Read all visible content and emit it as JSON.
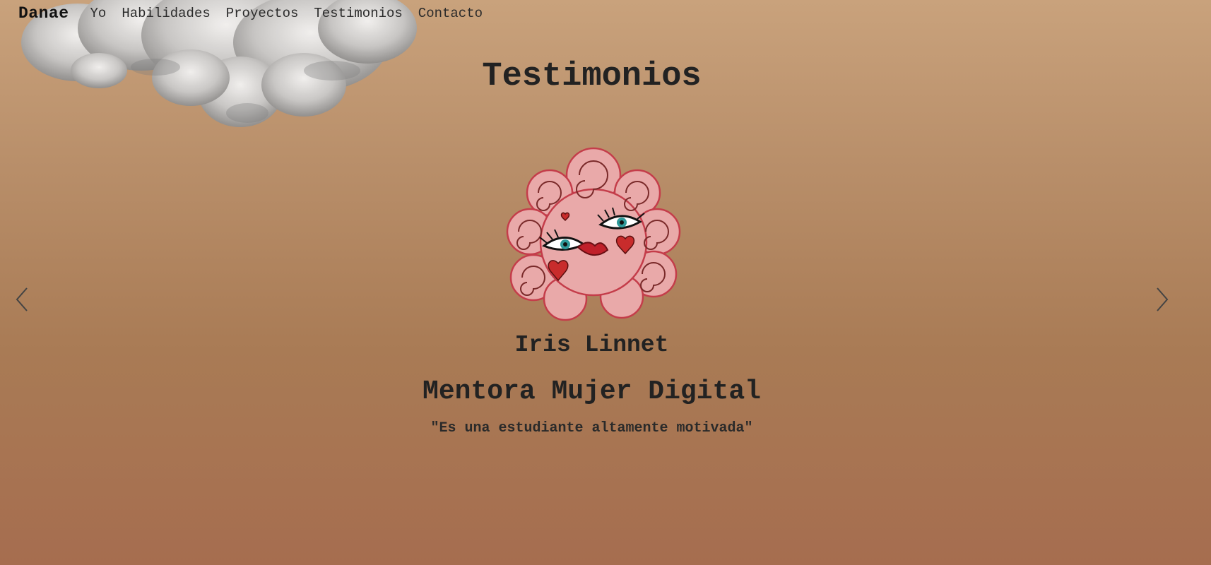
{
  "nav": {
    "brand": "Danae",
    "links": [
      "Yo",
      "Habilidades",
      "Proyectos",
      "Testimonios",
      "Contacto"
    ]
  },
  "section": {
    "title": "Testimonios"
  },
  "testimonial": {
    "name": "Iris Linnet",
    "role": "Mentora Mujer Digital",
    "quote": "\"Es una estudiante altamente motivada\""
  },
  "carousel": {
    "prev_icon": "chevron-left-icon",
    "next_icon": "chevron-right-icon"
  },
  "colors": {
    "background_top": "#c9a27c",
    "background_bottom": "#a66d4f",
    "text": "#222222"
  }
}
